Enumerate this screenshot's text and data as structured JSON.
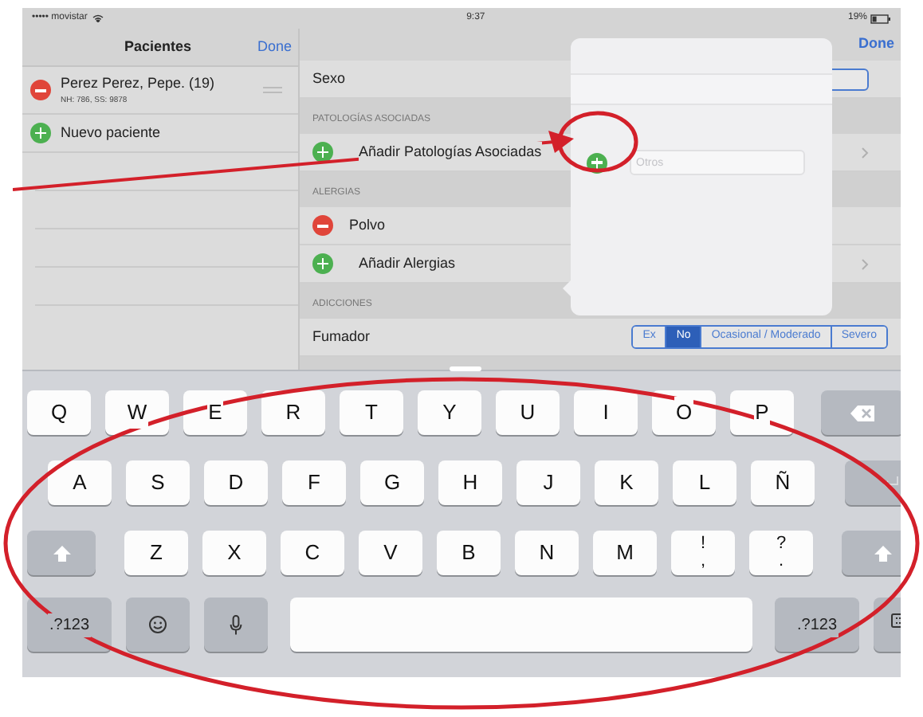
{
  "status_bar": {
    "carrier": "••••• movistar",
    "time": "9:37",
    "battery": "19%"
  },
  "patients_pane": {
    "title": "Pacientes",
    "done": "Done",
    "rows": [
      {
        "kind": "remove",
        "name": "Perez Perez, Pepe. (19)",
        "detail": "NH: 786, SS: 9878"
      },
      {
        "kind": "add",
        "name": "Nuevo paciente"
      }
    ]
  },
  "detail_pane": {
    "done": "Done",
    "sections": [
      {
        "rows": [
          {
            "kind": "plain",
            "label": "Sexo",
            "has_button": true,
            "disclosure": false
          }
        ]
      },
      {
        "header": "PATOLOGÍAS ASOCIADAS",
        "rows": [
          {
            "kind": "add",
            "label": "Añadir Patologías Asociadas",
            "disclosure": true
          }
        ]
      },
      {
        "header": "ALERGIAS",
        "rows": [
          {
            "kind": "remove",
            "label": "Polvo",
            "disclosure": false
          },
          {
            "kind": "add",
            "label": "Añadir Alergias",
            "disclosure": true
          }
        ]
      },
      {
        "header": "ADICCIONES",
        "rows": [
          {
            "kind": "segmented",
            "label": "Fumador",
            "disclosure": false,
            "segments": [
              {
                "label": "Ex",
                "selected": false
              },
              {
                "label": "No",
                "selected": true
              },
              {
                "label": "Ocasional / Moderado",
                "selected": false
              },
              {
                "label": "Severo",
                "selected": false
              }
            ]
          }
        ]
      }
    ]
  },
  "popover": {
    "placeholder": "Otros"
  },
  "keyboard": {
    "rows": [
      [
        {
          "kind": "char",
          "label": "Q"
        },
        {
          "kind": "char",
          "label": "W"
        },
        {
          "kind": "char",
          "label": "E"
        },
        {
          "kind": "char",
          "label": "R"
        },
        {
          "kind": "char",
          "label": "T"
        },
        {
          "kind": "char",
          "label": "Y"
        },
        {
          "kind": "char",
          "label": "U"
        },
        {
          "kind": "char",
          "label": "I"
        },
        {
          "kind": "char",
          "label": "O"
        },
        {
          "kind": "char",
          "label": "P"
        },
        {
          "kind": "backspace"
        }
      ],
      [
        {
          "kind": "char",
          "label": "A"
        },
        {
          "kind": "char",
          "label": "S"
        },
        {
          "kind": "char",
          "label": "D"
        },
        {
          "kind": "char",
          "label": "F"
        },
        {
          "kind": "char",
          "label": "G"
        },
        {
          "kind": "char",
          "label": "H"
        },
        {
          "kind": "char",
          "label": "J"
        },
        {
          "kind": "char",
          "label": "K"
        },
        {
          "kind": "char",
          "label": "L"
        },
        {
          "kind": "char",
          "label": "Ñ"
        },
        {
          "kind": "return"
        }
      ],
      [
        {
          "kind": "shift"
        },
        {
          "kind": "char",
          "label": "Z"
        },
        {
          "kind": "char",
          "label": "X"
        },
        {
          "kind": "char",
          "label": "C"
        },
        {
          "kind": "char",
          "label": "V"
        },
        {
          "kind": "char",
          "label": "B"
        },
        {
          "kind": "char",
          "label": "N"
        },
        {
          "kind": "char",
          "label": "M"
        },
        {
          "kind": "dual",
          "label": "!",
          "sub": ","
        },
        {
          "kind": "dual",
          "label": "?",
          "sub": "."
        },
        {
          "kind": "shift"
        }
      ],
      [
        {
          "kind": "mode",
          "label": ".?123"
        },
        {
          "kind": "emoji"
        },
        {
          "kind": "mic"
        },
        {
          "kind": "space"
        },
        {
          "kind": "mode",
          "label": ".?123"
        },
        {
          "kind": "hide"
        }
      ]
    ]
  }
}
